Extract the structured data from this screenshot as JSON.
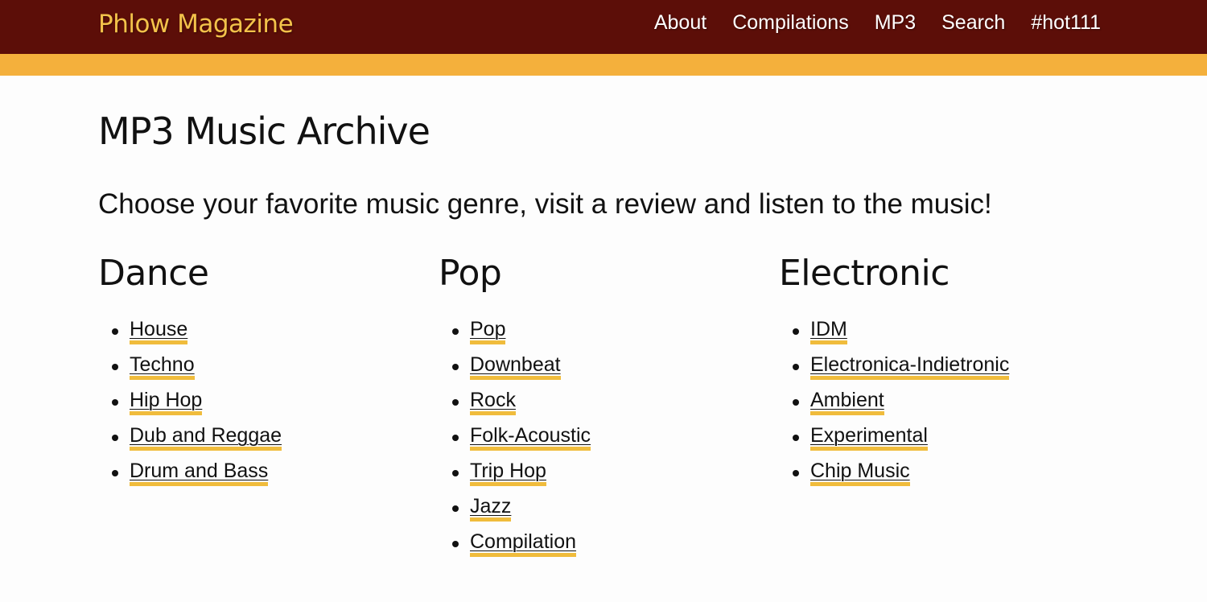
{
  "header": {
    "brand": "Phlow Magazine",
    "nav": [
      "About",
      "Compilations",
      "MP3",
      "Search",
      "#hot111"
    ]
  },
  "colors": {
    "header_bg": "#5c0e08",
    "stripe": "#f4b03c",
    "brand": "#f3c24a",
    "link_underline": "#f0bc3c"
  },
  "main": {
    "title": "MP3 Music Archive",
    "lead": "Choose your favorite music genre, visit a review and listen to the music!",
    "columns": [
      {
        "heading": "Dance",
        "items": [
          "House",
          "Techno",
          "Hip Hop",
          "Dub and Reggae",
          "Drum and Bass"
        ]
      },
      {
        "heading": "Pop",
        "items": [
          "Pop",
          "Downbeat",
          "Rock",
          "Folk-Acoustic",
          "Trip Hop",
          "Jazz",
          "Compilation"
        ]
      },
      {
        "heading": "Electronic",
        "items": [
          "IDM",
          "Electronica-Indietronic",
          "Ambient",
          "Experimental",
          "Chip Music"
        ]
      }
    ]
  }
}
